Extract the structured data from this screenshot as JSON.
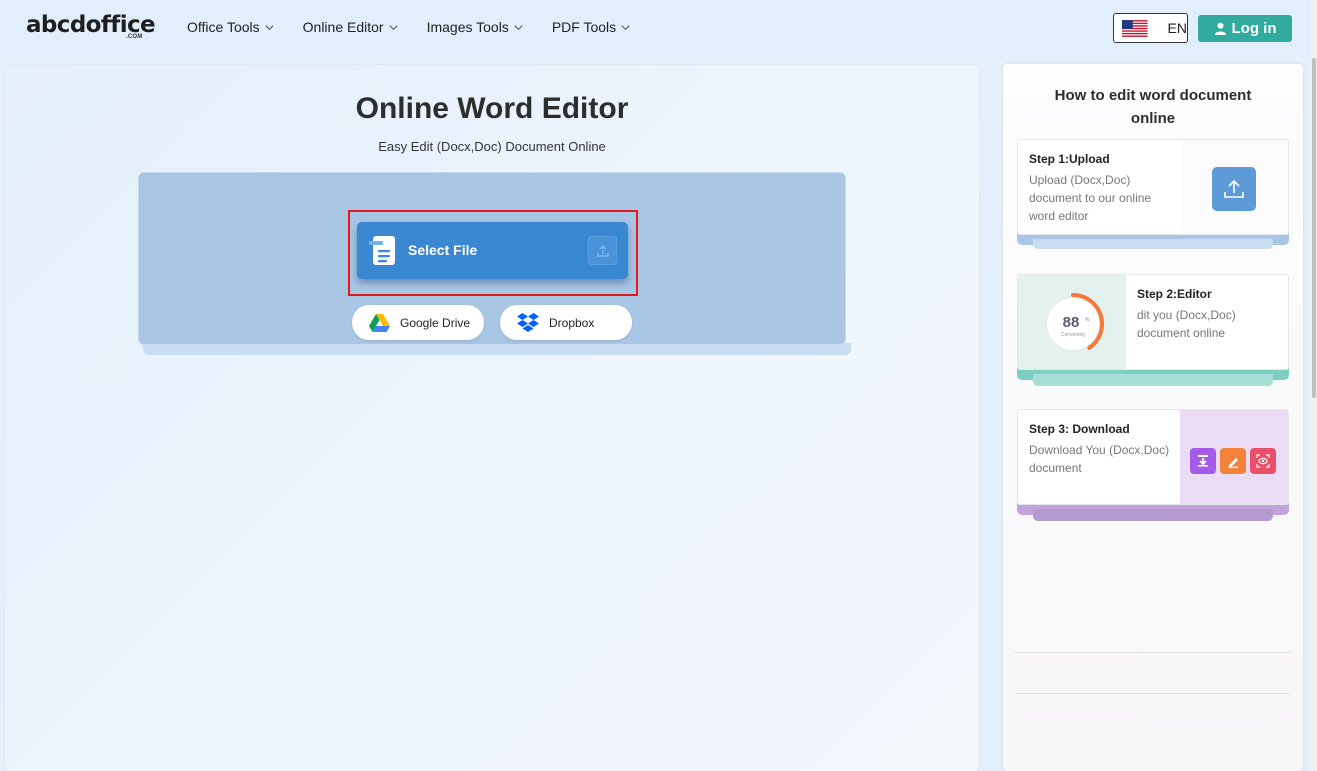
{
  "header": {
    "logo": "abcdoffice",
    "logo_sub": ".COM",
    "nav": [
      {
        "label": "Office Tools"
      },
      {
        "label": "Online Editor"
      },
      {
        "label": "Images Tools"
      },
      {
        "label": "PDF Tools"
      }
    ],
    "language": "EN",
    "login": "Log in",
    "login_color": "#32ab9f"
  },
  "main": {
    "title": "Online Word Editor",
    "subtitle": "Easy Edit (Docx,Doc) Document Online",
    "select_file": "Select File",
    "google_drive": "Google Drive",
    "dropbox": "Dropbox",
    "accent": "#3a87d2",
    "highlight": "#e31b1b"
  },
  "sidebar": {
    "title": "How to edit word document online",
    "steps": [
      {
        "title": "Step 1:Upload",
        "desc": "Upload (Docx,Doc) document to our online word editor"
      },
      {
        "title": "Step 2:Editor",
        "desc": "dit you (Docx,Doc) document online",
        "progress_value": "88",
        "progress_unit": "%",
        "progress_label": "Converting",
        "progress_fraction": 0.88
      },
      {
        "title": "Step 3: Download",
        "desc": "Download You (Docx,Doc) document"
      }
    ]
  },
  "icons": {
    "logo": "abcdoffice-logo",
    "flag": "us-flag-icon",
    "user": "user-icon",
    "document": "document-icon",
    "upload": "upload-icon",
    "google_drive": "google-drive-icon",
    "dropbox": "dropbox-icon",
    "download": "download-icon",
    "edit": "pencil-icon",
    "view": "eye-icon"
  }
}
